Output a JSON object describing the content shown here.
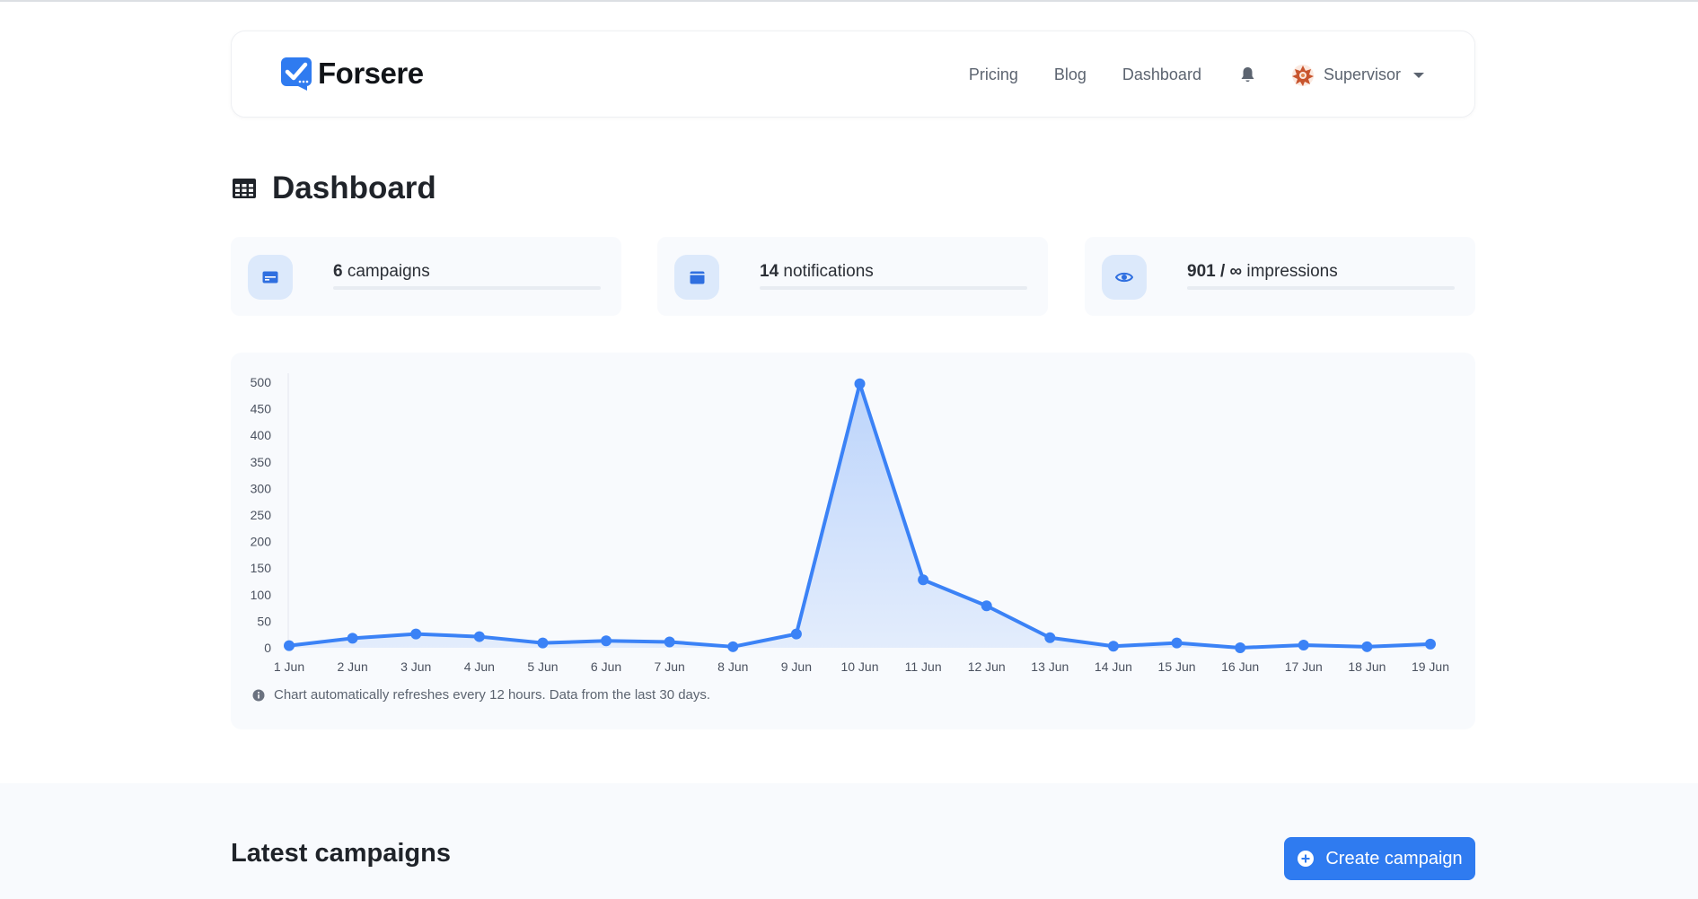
{
  "brand": {
    "name": "Forsere",
    "accent": "#2f7bf0"
  },
  "nav": {
    "links": [
      "Pricing",
      "Blog",
      "Dashboard"
    ],
    "bell_icon": "bell-icon",
    "user": {
      "name": "Supervisor",
      "avatar_icon": "geometric-avatar-icon"
    }
  },
  "page": {
    "title": "Dashboard",
    "icon": "table-grid-icon"
  },
  "stats": [
    {
      "value": "6",
      "label": "campaigns",
      "icon": "card-icon"
    },
    {
      "value": "14",
      "label": "notifications",
      "icon": "window-icon"
    },
    {
      "value": "901 / ∞",
      "label": "impressions",
      "icon": "eye-icon"
    }
  ],
  "chart_data": {
    "type": "area",
    "title": "",
    "xlabel": "",
    "ylabel": "",
    "categories": [
      "1 Jun",
      "2 Jun",
      "3 Jun",
      "4 Jun",
      "5 Jun",
      "6 Jun",
      "7 Jun",
      "8 Jun",
      "9 Jun",
      "10 Jun",
      "11 Jun",
      "12 Jun",
      "13 Jun",
      "14 Jun",
      "15 Jun",
      "16 Jun",
      "17 Jun",
      "18 Jun",
      "19 Jun"
    ],
    "values": [
      4,
      18,
      26,
      21,
      9,
      13,
      11,
      2,
      26,
      497,
      128,
      79,
      19,
      3,
      9,
      0,
      5,
      2,
      7
    ],
    "ylim": [
      0,
      500
    ],
    "yticks": [
      0,
      50,
      100,
      150,
      200,
      250,
      300,
      350,
      400,
      450,
      500
    ],
    "grid": false,
    "legend": "none",
    "line_color": "#3b82f6",
    "fill_color": "#bcd4fb"
  },
  "chart_note": {
    "text": "Chart automatically refreshes every 12 hours. Data from the last 30 days.",
    "icon": "info-icon"
  },
  "section": {
    "title": "Latest campaigns"
  },
  "create_button": {
    "label": "Create campaign",
    "icon": "plus-circle-icon"
  }
}
